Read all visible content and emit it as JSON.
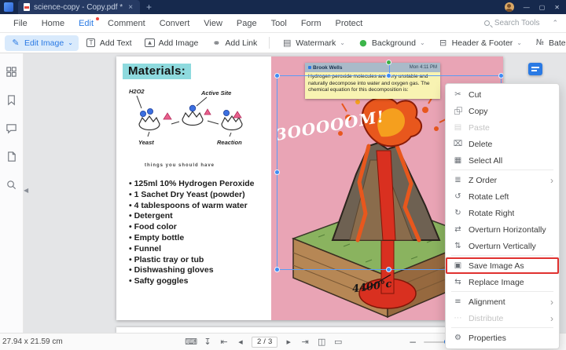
{
  "app": {
    "tab_title": "science-copy - Copy.pdf *",
    "tab_close": "×",
    "new_tab_label": "+",
    "window_controls": {
      "minimize": "—",
      "maximize": "▢",
      "close": "✕"
    }
  },
  "menubar": {
    "items": [
      {
        "label": "File"
      },
      {
        "label": "Home"
      },
      {
        "label": "Edit",
        "active": true,
        "badge": true
      },
      {
        "label": "Comment"
      },
      {
        "label": "Convert"
      },
      {
        "label": "View"
      },
      {
        "label": "Page"
      },
      {
        "label": "Tool"
      },
      {
        "label": "Form"
      },
      {
        "label": "Protect"
      }
    ],
    "search_label": "Search Tools"
  },
  "toolbar": {
    "left": [
      {
        "label": "Edit Image",
        "icon": "pencil",
        "dropdown": true,
        "active": true
      },
      {
        "label": "Add Text",
        "icon": "add-text"
      },
      {
        "label": "Add Image",
        "icon": "add-image"
      },
      {
        "label": "Add Link",
        "icon": "add-link"
      }
    ],
    "right": [
      {
        "label": "Watermark",
        "icon": "watermark",
        "dropdown": true
      },
      {
        "label": "Background",
        "icon": "background",
        "dropdown": true
      },
      {
        "label": "Header & Footer",
        "icon": "header-footer",
        "dropdown": true
      },
      {
        "label": "Bates Number",
        "icon": "bates",
        "dropdown": true
      }
    ]
  },
  "sidebar": {
    "items": [
      "thumbnails",
      "bookmarks",
      "comments",
      "attachments",
      "search"
    ]
  },
  "document": {
    "materials_heading": "Materials:",
    "diagram": {
      "label_h2o2": "H2O2",
      "label_active_site": "Active Site",
      "label_yeast": "Yeast",
      "label_reaction": "Reaction",
      "caption": "things you should have"
    },
    "materials_list": [
      "125ml 10% Hydrogen Peroxide",
      "1 Sachet Dry Yeast (powder)",
      "4 tablespoons of warm water",
      "Detergent",
      "Food color",
      "Empty bottle",
      "Funnel",
      "Plastic tray or tub",
      "Dishwashing gloves",
      "Safty goggles"
    ],
    "note": {
      "author": "Brook Wells",
      "time": "Mon 4:11 PM",
      "text": "Hydrogen peroxide molecules are very unstable and naturally decompose into water and oxygen gas. The chemical equation for this decomposition is:"
    },
    "boom_text": "3OOOOOM!",
    "temperature": "4400°c"
  },
  "context_menu": {
    "items": [
      {
        "label": "Cut",
        "icon": "cut"
      },
      {
        "label": "Copy",
        "icon": "copy"
      },
      {
        "label": "Paste",
        "icon": "paste",
        "enabled": false
      },
      {
        "label": "Delete",
        "icon": "delete"
      },
      {
        "label": "Select All",
        "icon": "select-all",
        "divider_after": true
      },
      {
        "label": "Z Order",
        "icon": "z-order",
        "submenu": true
      },
      {
        "label": "Rotate Left",
        "icon": "rotate-left"
      },
      {
        "label": "Rotate Right",
        "icon": "rotate-right"
      },
      {
        "label": "Overturn Horizontally",
        "icon": "flip-horizontal"
      },
      {
        "label": "Overturn Vertically",
        "icon": "flip-vertical",
        "divider_after": true
      },
      {
        "label": "Save Image As",
        "icon": "save-image",
        "highlighted": true
      },
      {
        "label": "Replace Image",
        "icon": "replace-image",
        "divider_after": true
      },
      {
        "label": "Alignment",
        "icon": "alignment",
        "submenu": true
      },
      {
        "label": "Distribute",
        "icon": "distribute",
        "enabled": false,
        "submenu": true,
        "divider_after": true
      },
      {
        "label": "Properties",
        "icon": "properties"
      }
    ]
  },
  "bottombar": {
    "dimensions": "27.94 x 21.59 cm",
    "tools_left": [
      {
        "icon": "keyboard"
      },
      {
        "icon": "download"
      },
      {
        "icon": "first-page"
      },
      {
        "icon": "prev-page"
      }
    ],
    "tools_right": [
      {
        "icon": "next-page"
      },
      {
        "icon": "last-page"
      },
      {
        "icon": "fit-width"
      },
      {
        "icon": "fit-page"
      }
    ],
    "page_current": "2",
    "page_separator": "/",
    "page_total": "3"
  }
}
